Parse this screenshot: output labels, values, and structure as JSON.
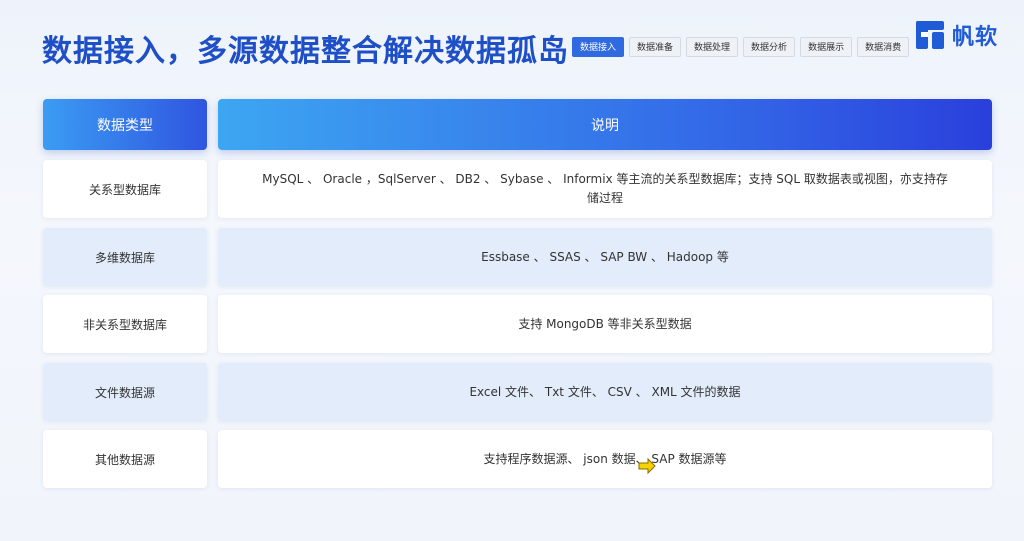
{
  "header": {
    "title": "数据接入，多源数据整合解决数据孤岛",
    "tabs": [
      "数据接入",
      "数据准备",
      "数据处理",
      "数据分析",
      "数据展示",
      "数据消费"
    ],
    "active_tab": 0
  },
  "logo": {
    "text": "帆软",
    "icon": "finereport-logo-icon"
  },
  "table": {
    "col_type": "数据类型",
    "col_desc": "说明",
    "rows": [
      {
        "type": "关系型数据库",
        "desc": "MySQL 、 Oracle ，SqlServer 、 DB2 、 Sybase 、 Informix 等主流的关系型数据库；支持 SQL 取数据表或视图，亦支持存储过程"
      },
      {
        "type": "多维数据库",
        "desc": "Essbase 、 SSAS 、 SAP BW 、 Hadoop 等"
      },
      {
        "type": "非关系型数据库",
        "desc": "支持 MongoDB 等非关系型数据"
      },
      {
        "type": "文件数据源",
        "desc": "Excel 文件、 Txt 文件、 CSV 、 XML 文件的数据"
      },
      {
        "type": "其他数据源",
        "desc": "支持程序数据源、 json 数据、 SAP 数据源等"
      }
    ]
  },
  "colors": {
    "accent": "#2f6ae0",
    "title": "#1f4fc7"
  }
}
